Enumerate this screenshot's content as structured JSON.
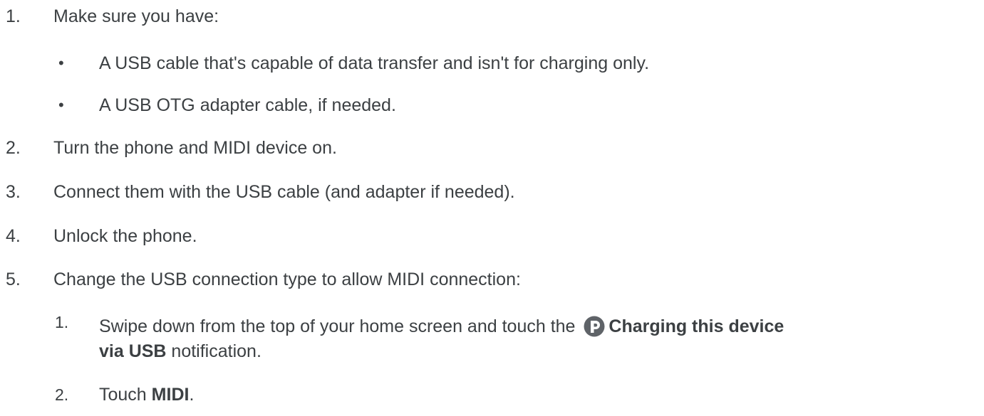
{
  "steps": [
    {
      "number": "1.",
      "text": "Make sure you have:"
    },
    {
      "number": "2.",
      "text": "Turn the phone and MIDI device on."
    },
    {
      "number": "3.",
      "text": "Connect them with the USB cable (and adapter if needed)."
    },
    {
      "number": "4.",
      "text": "Unlock the phone."
    },
    {
      "number": "5.",
      "text": "Change the USB connection type to allow MIDI connection:"
    }
  ],
  "requirements": [
    {
      "bullet": "•",
      "text": "A USB cable that's capable of data transfer and isn't for charging only."
    },
    {
      "bullet": "•",
      "text": "A USB OTG adapter cable, if needed."
    }
  ],
  "substeps": [
    {
      "number": "1.",
      "text_before": "Swipe down from the top of your home screen and touch the ",
      "icon": "usb-notification-icon",
      "bold_1": "Charging this device",
      "bold_2": "via USB",
      "text_after": " notification."
    },
    {
      "number": "2.",
      "text_before": "Touch ",
      "bold": "MIDI",
      "text_after": "."
    }
  ],
  "colors": {
    "text": "#3c4043",
    "icon": "#5f6368"
  }
}
